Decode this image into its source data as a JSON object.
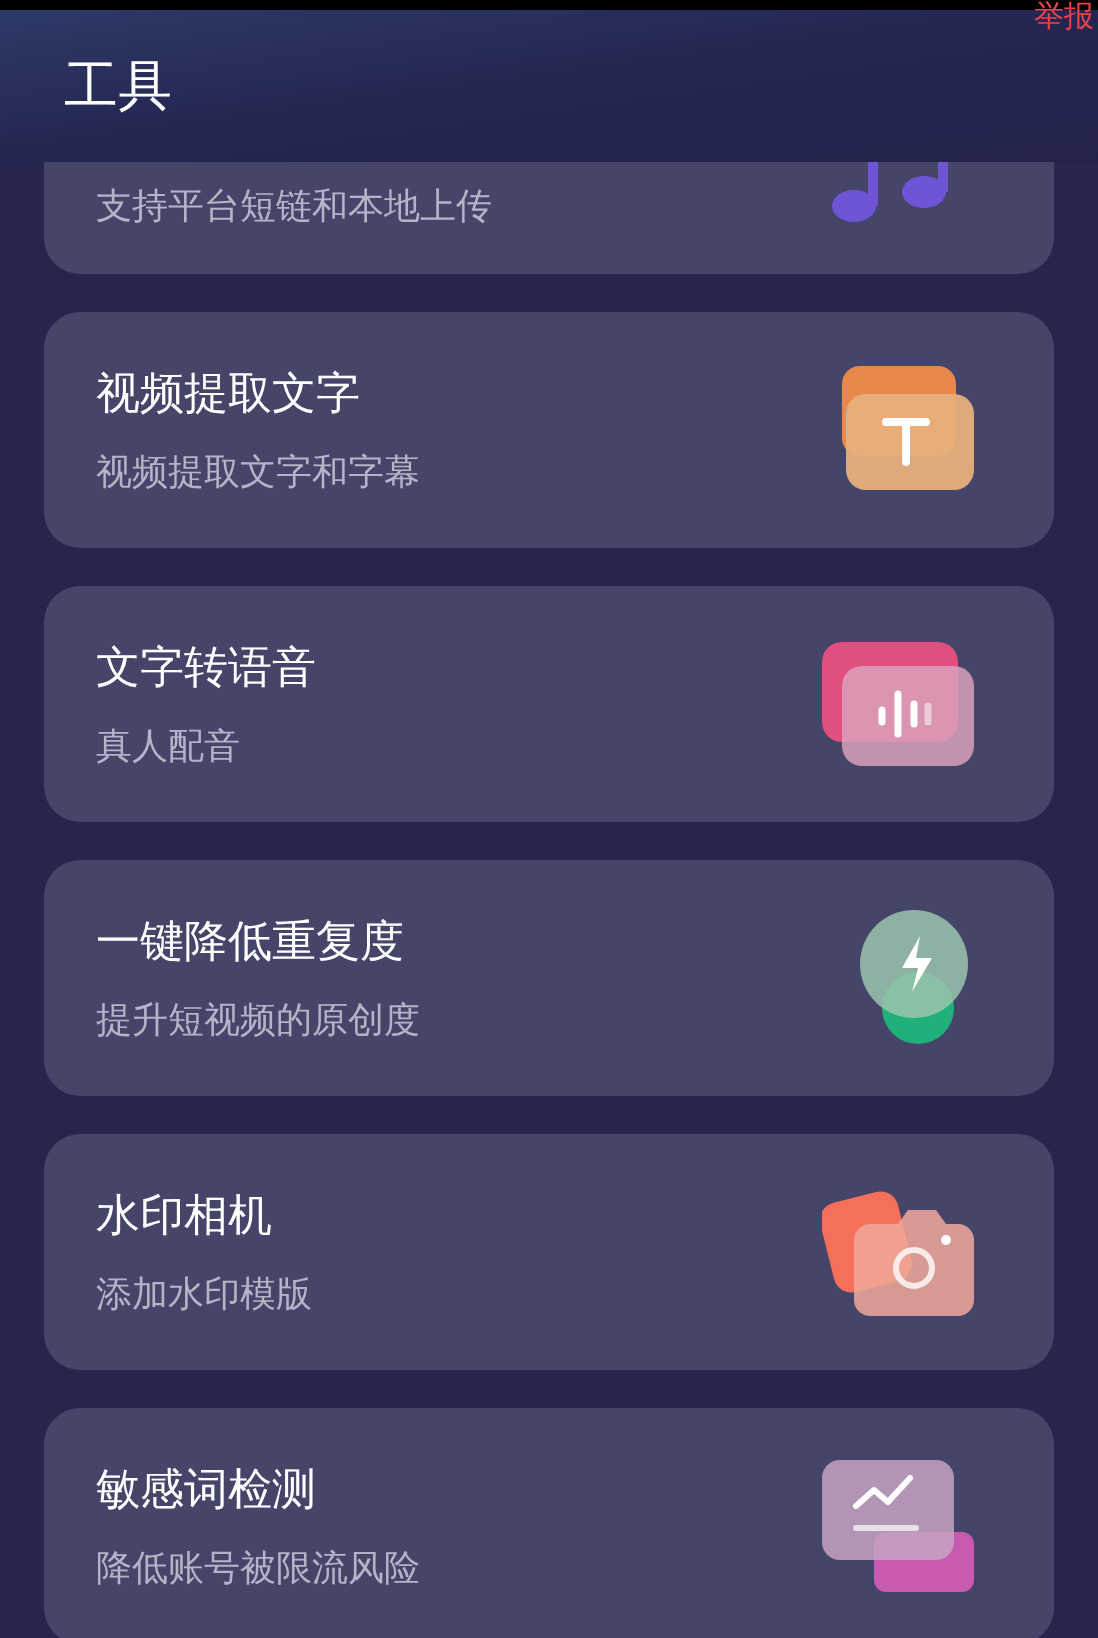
{
  "report_link": "举报",
  "header": {
    "title": "工具"
  },
  "tools": [
    {
      "kind": "music",
      "subtitle": "支持平台短链和本地上传"
    },
    {
      "kind": "text",
      "title": "视频提取文字",
      "subtitle": "视频提取文字和字幕"
    },
    {
      "kind": "voice",
      "title": "文字转语音",
      "subtitle": "真人配音"
    },
    {
      "kind": "bolt",
      "title": "一键降低重复度",
      "subtitle": "提升短视频的原创度"
    },
    {
      "kind": "camera",
      "title": "水印相机",
      "subtitle": "添加水印模版"
    },
    {
      "kind": "chart",
      "title": "敏感词检测",
      "subtitle": "降低账号被限流风险"
    }
  ]
}
